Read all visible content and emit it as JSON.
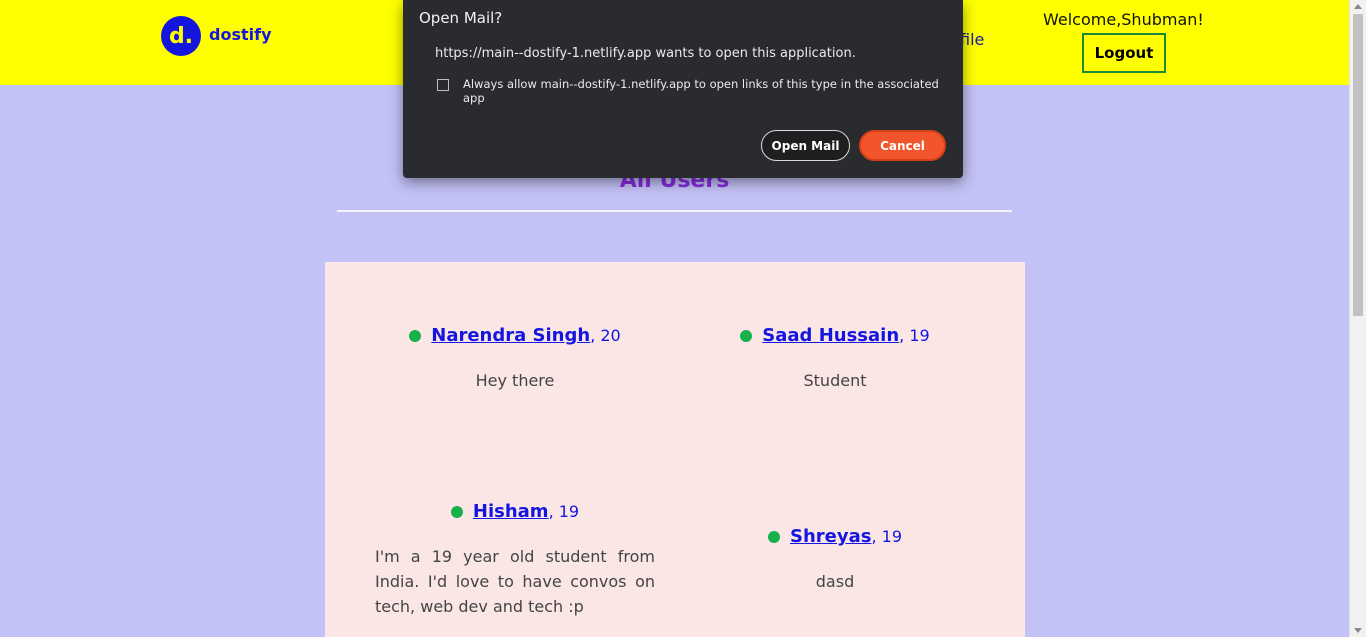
{
  "header": {
    "logo_letter": "d.",
    "logo_text": "dostify",
    "nav_link_partial": "file",
    "welcome": "Welcome,Shubman!",
    "logout_label": "Logout"
  },
  "main": {
    "title": "All Users"
  },
  "users": [
    {
      "name": "Narendra Singh",
      "age": ", 20",
      "bio": "Hey there"
    },
    {
      "name": "Saad Hussain ",
      "age": ", 19",
      "bio": "Student"
    },
    {
      "name": "Hisham",
      "age": ", 19",
      "bio": "I'm a 19 year old student from India. I'd love to have convos on tech, web dev and tech :p"
    },
    {
      "name": "Shreyas",
      "age": ", 19",
      "bio": "dasd"
    }
  ],
  "dialog": {
    "title": "Open Mail?",
    "message": "https://main--dostify-1.netlify.app wants to open this application.",
    "checkbox_label": "Always allow main--dostify-1.netlify.app to open links of this type in the associated app",
    "open_label": "Open Mail",
    "cancel_label": "Cancel"
  },
  "colors": {
    "header_bg": "#ffff00",
    "page_bg": "#c3c2f7",
    "brand_blue": "#1515e0",
    "title_purple": "#8a2be2",
    "panel_bg": "#fbe6e6",
    "online_green": "#18b04a",
    "cancel_orange": "#f2552b"
  }
}
